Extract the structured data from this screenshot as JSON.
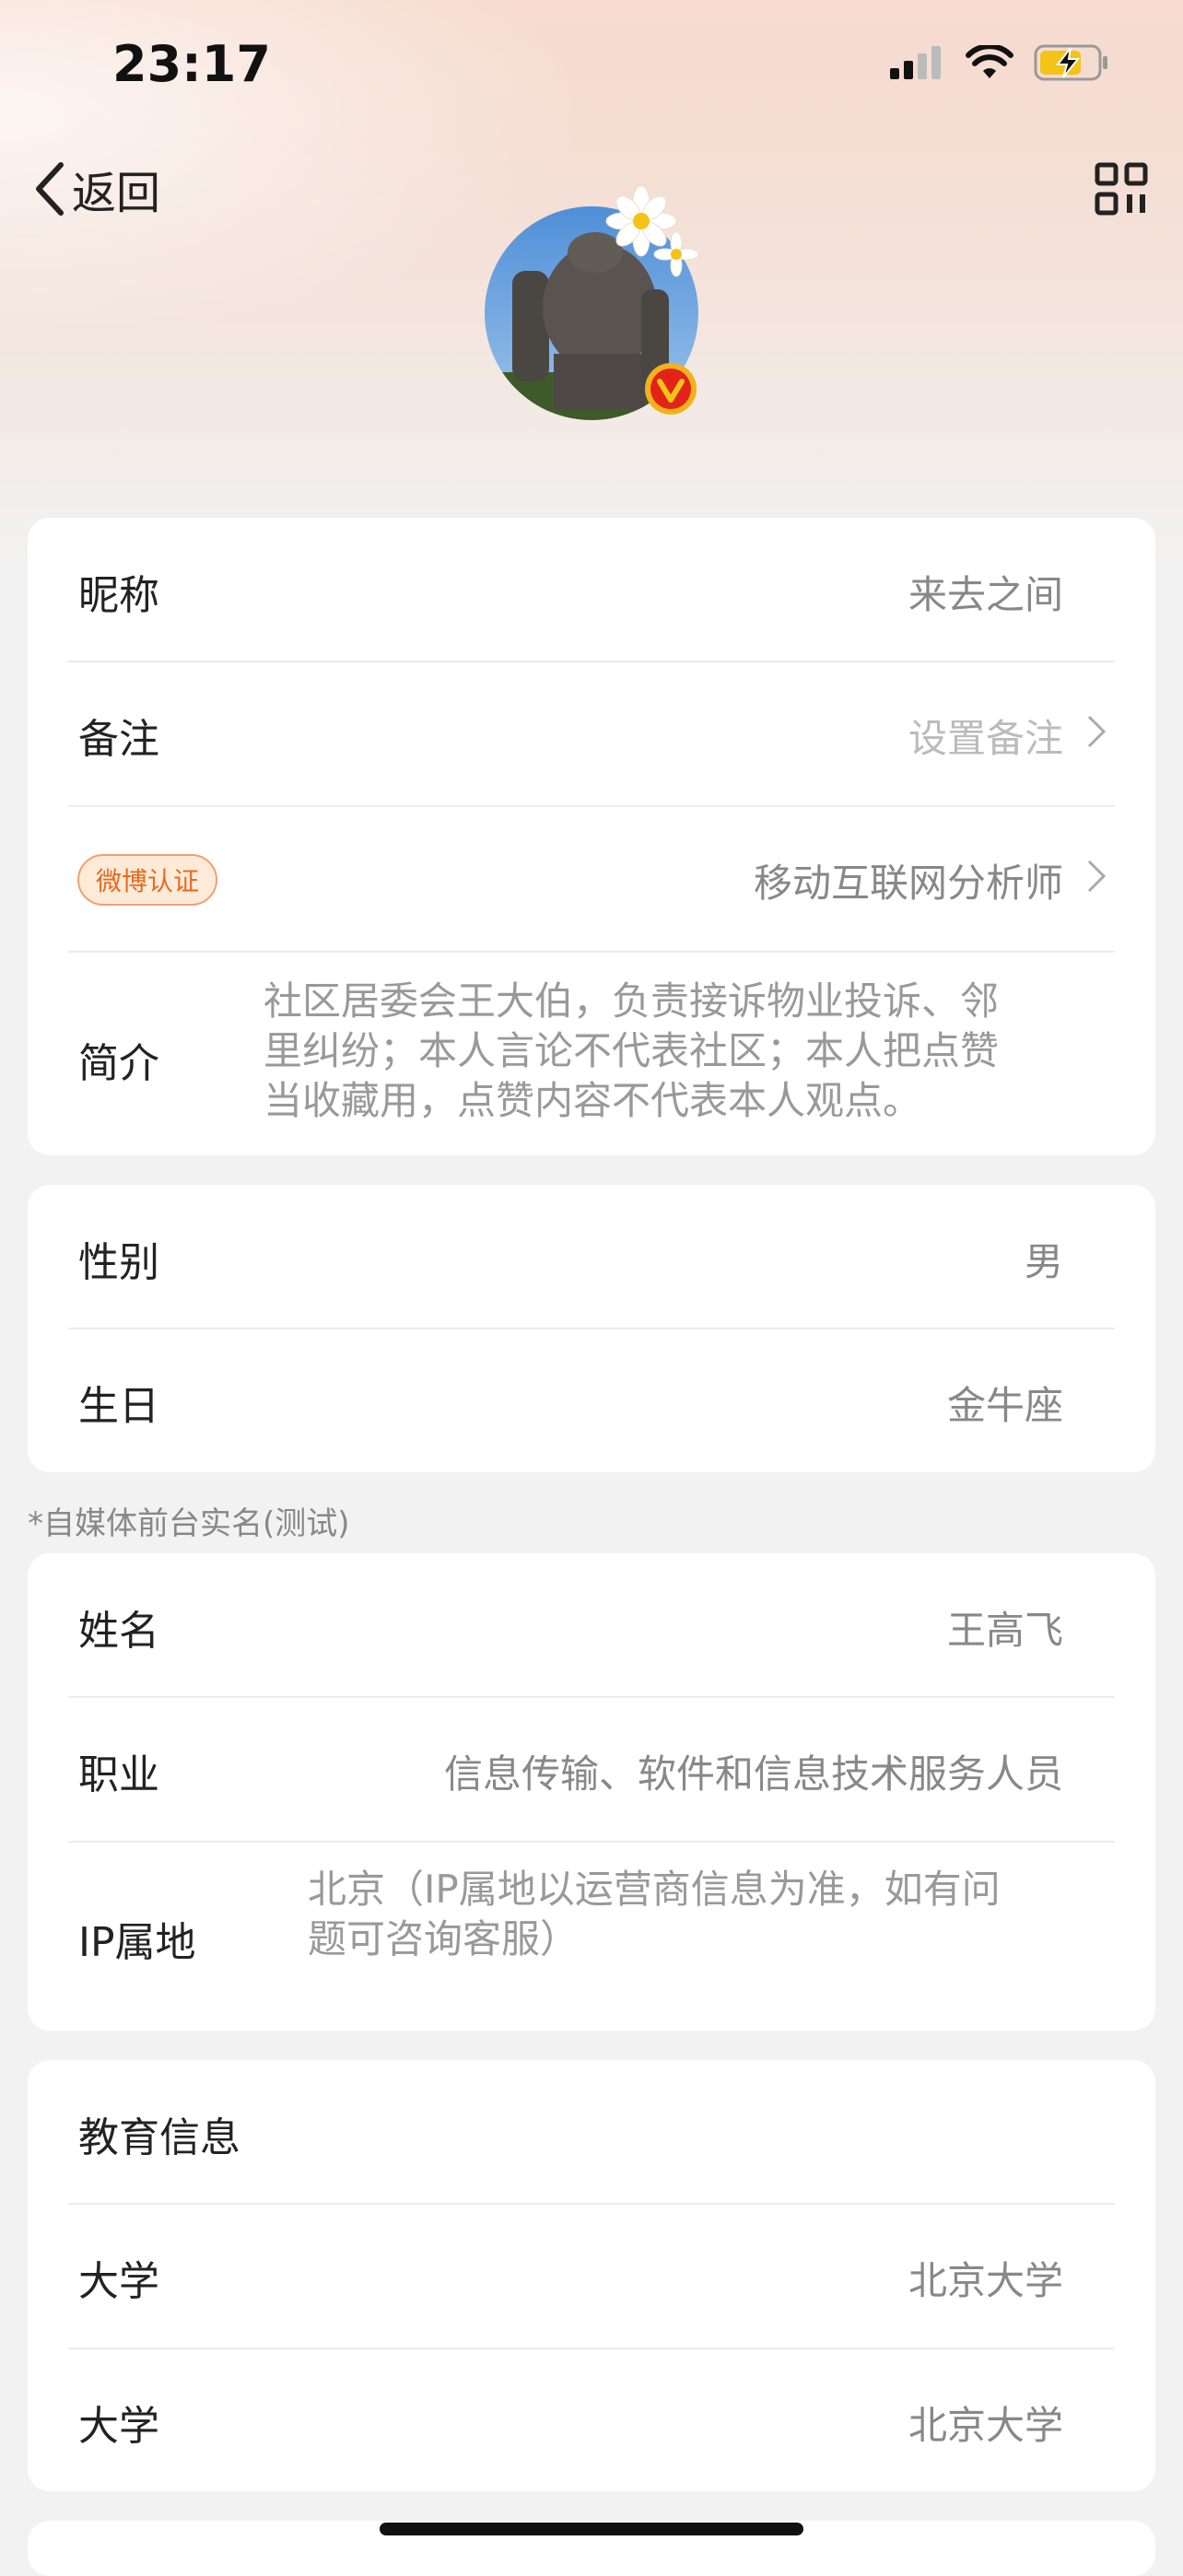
{
  "status_bar": {
    "time": "23:17"
  },
  "nav": {
    "back_label": "返回"
  },
  "profile_card": {
    "nickname_label": "昵称",
    "nickname_value": "来去之间",
    "remark_label": "备注",
    "remark_value": "设置备注",
    "verify_badge": "微博认证",
    "verify_value": "移动互联网分析师",
    "bio_label": "简介",
    "bio_lines": [
      "社区居委会王大伯，负责接诉物业投诉、邻",
      "里纠纷；本人言论不代表社区；本人把点赞",
      "当收藏用，点赞内容不代表本人观点。"
    ]
  },
  "basic_card": {
    "gender_label": "性别",
    "gender_value": "男",
    "birthday_label": "生日",
    "birthday_value": "金牛座"
  },
  "realname_note": "*自媒体前台实名(测试)",
  "realname_card": {
    "name_label": "姓名",
    "name_value": "王高飞",
    "job_label": "职业",
    "job_value": "信息传输、软件和信息技术服务人员",
    "ip_label": "IP属地",
    "ip_lines": [
      "北京（IP属地以运营商信息为准，如有问",
      "题可咨询客服）"
    ]
  },
  "education_card": {
    "title": "教育信息",
    "items": [
      {
        "label": "大学",
        "value": "北京大学"
      },
      {
        "label": "大学",
        "value": "北京大学"
      }
    ]
  },
  "colors": {
    "accent": "#e76a1e",
    "badge_bg": "#fdebd8",
    "muted_text": "#999999"
  },
  "icons": [
    "signal-icon",
    "wifi-icon",
    "battery-charging-icon",
    "back-chevron-icon",
    "qr-code-icon",
    "verified-v-icon",
    "chevron-right-icon"
  ]
}
